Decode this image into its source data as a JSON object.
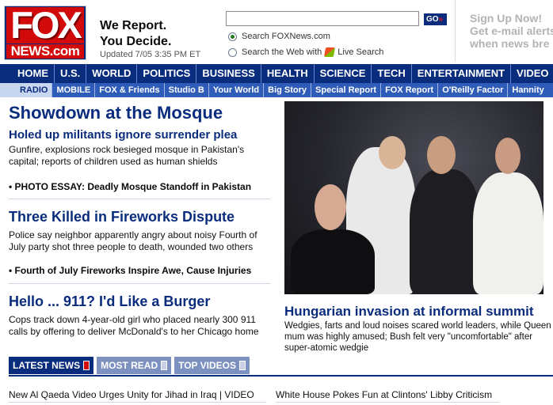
{
  "header": {
    "logo_top": "FOX",
    "logo_bottom": "NEWS.com",
    "slogan_line1": "We Report.",
    "slogan_line2": "You Decide.",
    "updated": "Updated 7/05 3:35 PM ET",
    "search": {
      "value": "",
      "go_label": "GO",
      "go_arrows": "»",
      "option_site": "Search FOXNews.com",
      "option_web": "Search the Web with",
      "option_web_brand": "Live Search",
      "selected": "site"
    },
    "signup": {
      "line1": "Sign Up Now!",
      "line2": "Get e-mail alerts",
      "line3": "when news bre"
    }
  },
  "nav_primary": [
    "HOME",
    "U.S.",
    "WORLD",
    "POLITICS",
    "BUSINESS",
    "HEALTH",
    "SCIENCE",
    "TECH",
    "ENTERTAINMENT",
    "VIDEO"
  ],
  "nav_secondary": [
    "RADIO",
    "MOBILE",
    "FOX & Friends",
    "Studio B",
    "Your World",
    "Big Story",
    "Special Report",
    "FOX Report",
    "O'Reilly Factor",
    "Hannity"
  ],
  "nav_secondary_selected": "RADIO",
  "main": {
    "top_headline": "Showdown at the Mosque",
    "top_subhead": "Holed up militants ignore surrender plea",
    "top_body": "Gunfire, explosions rock besieged mosque in Pakistan's capital; reports of children used as human shields",
    "top_bullet": "• PHOTO ESSAY: Deadly Mosque Standoff in Pakistan",
    "second_headline": "Three Killed in Fireworks Dispute",
    "second_body": "Police say neighbor apparently angry about noisy Fourth of July party shot three people to death, wounded two others",
    "second_bullet": "• Fourth of July Fireworks Inspire Awe, Cause Injuries",
    "third_headline": "Hello ... 911? I'd Like a Burger",
    "third_body": "Cops track down 4-year-old girl who placed nearly 300 911 calls by offering to deliver McDonald's to her Chicago home"
  },
  "feature": {
    "title": "Hungarian invasion at informal summit",
    "text": "Wedgies, farts and loud noises scared world leaders, while Queen mum was highly amused; Bush felt very \"uncomfortable\" after super-atomic wedgie"
  },
  "tabs": [
    "LATEST NEWS",
    "MOST READ",
    "TOP VIDEOS"
  ],
  "tabs_active": "LATEST NEWS",
  "stories": [
    "New Al Qaeda Video Urges Unity for Jihad in Iraq | VIDEO",
    "White House Pokes Fun at Clintons' Libby Criticism"
  ],
  "colors": {
    "brand_blue": "#0a2c7c",
    "secondary_blue": "#2e5cb8",
    "brand_red": "#d30a0a"
  }
}
